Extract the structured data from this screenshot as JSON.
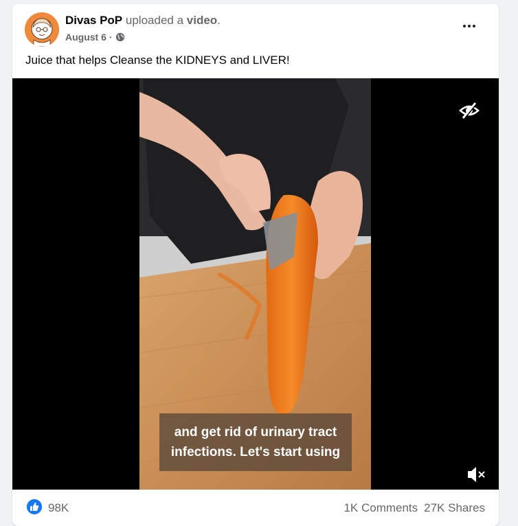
{
  "post": {
    "author": "Divas PoP",
    "action_prefix": "uploaded a",
    "action_object": "video",
    "action_suffix": ".",
    "date": "August 6",
    "date_separator": "·",
    "caption": "Juice that helps Cleanse the KIDNEYS and LIVER!",
    "audience_icon": "globe-icon",
    "menu_icon": "more-options-icon"
  },
  "video": {
    "subtitle_line1": "and get rid of urinary tract",
    "subtitle_line2": "infections. Let's start using",
    "hide_icon": "eye-slash-icon",
    "mute_icon": "speaker-muted-icon"
  },
  "footer": {
    "like_count": "98K",
    "comments": "1K Comments",
    "shares": "27K Shares"
  },
  "colors": {
    "brand_blue": "#1877f2",
    "avatar_orange": "#ef8a3c",
    "card_bg": "#ffffff",
    "page_bg": "#f0f2f5"
  }
}
